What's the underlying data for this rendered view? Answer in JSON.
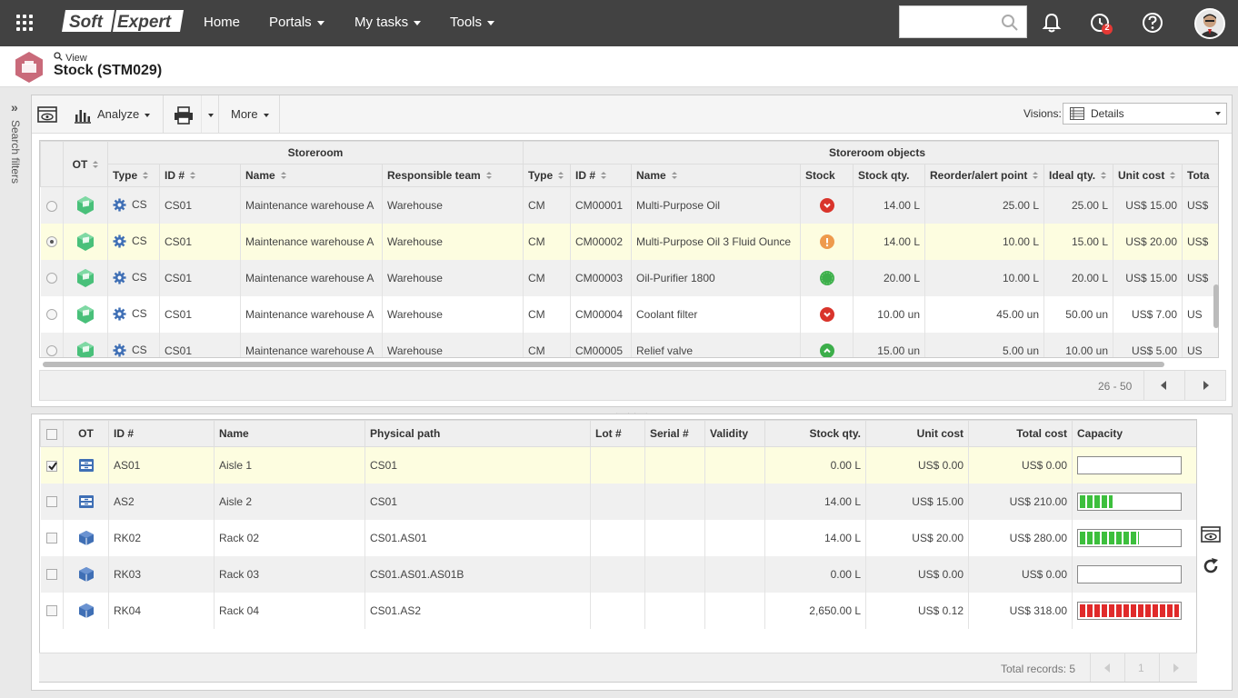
{
  "nav": {
    "logo_soft": "Soft",
    "logo_expert": "Expert",
    "items": [
      {
        "label": "Home",
        "dropdown": false
      },
      {
        "label": "Portals",
        "dropdown": true
      },
      {
        "label": "My tasks",
        "dropdown": true
      },
      {
        "label": "Tools",
        "dropdown": true
      }
    ],
    "search_placeholder": "",
    "task_badge": "2"
  },
  "header": {
    "view_link": "View",
    "title": "Stock (STM029)"
  },
  "left_rail": {
    "label": "Search filters"
  },
  "toolbar": {
    "analyze_label": "Analyze",
    "more_label": "More",
    "visions_label": "Visions:",
    "visions_value": "Details"
  },
  "grid1": {
    "group_headers": {
      "ot": "OT",
      "storeroom": "Storeroom",
      "objects": "Storeroom objects"
    },
    "columns": {
      "s_type": "Type",
      "s_id": "ID #",
      "s_name": "Name",
      "s_team": "Responsible team",
      "o_type": "Type",
      "o_id": "ID #",
      "o_name": "Name",
      "o_stock": "Stock",
      "o_qty": "Stock qty.",
      "o_reorder": "Reorder/alert point",
      "o_ideal": "Ideal qty.",
      "o_unit": "Unit cost",
      "o_total": "Tota"
    },
    "rows": [
      {
        "s_type": "CS",
        "s_id": "CS01",
        "s_name": "Maintenance warehouse A",
        "s_team": "Warehouse",
        "o_type": "CM",
        "o_id": "CM00001",
        "o_name": "Multi-Purpose Oil",
        "stock_status": "below",
        "qty": "14.00 L",
        "reorder": "25.00 L",
        "ideal": "25.00 L",
        "unit": "US$ 15.00",
        "total": "US$"
      },
      {
        "s_type": "CS",
        "s_id": "CS01",
        "s_name": "Maintenance warehouse A",
        "s_team": "Warehouse",
        "o_type": "CM",
        "o_id": "CM00002",
        "o_name": "Multi-Purpose Oil 3 Fluid Ounce",
        "stock_status": "alert",
        "qty": "14.00 L",
        "reorder": "10.00 L",
        "ideal": "15.00 L",
        "unit": "US$ 20.00",
        "total": "US$"
      },
      {
        "s_type": "CS",
        "s_id": "CS01",
        "s_name": "Maintenance warehouse A",
        "s_team": "Warehouse",
        "o_type": "CM",
        "o_id": "CM00003",
        "o_name": "Oil-Purifier 1800",
        "stock_status": "ok",
        "qty": "20.00 L",
        "reorder": "10.00 L",
        "ideal": "20.00 L",
        "unit": "US$ 15.00",
        "total": "US$"
      },
      {
        "s_type": "CS",
        "s_id": "CS01",
        "s_name": "Maintenance warehouse A",
        "s_team": "Warehouse",
        "o_type": "CM",
        "o_id": "CM00004",
        "o_name": "Coolant filter",
        "stock_status": "below",
        "qty": "10.00 un",
        "reorder": "45.00 un",
        "ideal": "50.00 un",
        "unit": "US$ 7.00",
        "total": "US"
      },
      {
        "s_type": "CS",
        "s_id": "CS01",
        "s_name": "Maintenance warehouse A",
        "s_team": "Warehouse",
        "o_type": "CM",
        "o_id": "CM00005",
        "o_name": "Relief valve",
        "stock_status": "above",
        "qty": "15.00 un",
        "reorder": "5.00 un",
        "ideal": "10.00 un",
        "unit": "US$ 5.00",
        "total": "US"
      }
    ],
    "range": "26 - 50"
  },
  "grid2": {
    "columns": {
      "ot": "OT",
      "id": "ID #",
      "name": "Name",
      "path": "Physical path",
      "lot": "Lot #",
      "serial": "Serial #",
      "validity": "Validity",
      "qty": "Stock qty.",
      "unit": "Unit cost",
      "total": "Total cost",
      "capacity": "Capacity"
    },
    "rows": [
      {
        "kind": "aisle",
        "id": "AS01",
        "name": "Aisle 1",
        "path": "CS01",
        "lot": "",
        "serial": "",
        "validity": "",
        "qty": "0.00 L",
        "unit": "US$ 0.00",
        "total": "US$ 0.00",
        "capacity": 0,
        "cap_color": "green",
        "checked": true
      },
      {
        "kind": "aisle",
        "id": "AS2",
        "name": "Aisle 2",
        "path": "CS01",
        "lot": "",
        "serial": "",
        "validity": "",
        "qty": "14.00 L",
        "unit": "US$ 15.00",
        "total": "US$ 210.00",
        "capacity": 0.33,
        "cap_color": "green",
        "checked": false
      },
      {
        "kind": "rack",
        "id": "RK02",
        "name": "Rack 02",
        "path": "CS01.AS01",
        "lot": "",
        "serial": "",
        "validity": "",
        "qty": "14.00 L",
        "unit": "US$ 20.00",
        "total": "US$ 280.00",
        "capacity": 0.6,
        "cap_color": "green",
        "checked": false
      },
      {
        "kind": "rack",
        "id": "RK03",
        "name": "Rack 03",
        "path": "CS01.AS01.AS01B",
        "lot": "",
        "serial": "",
        "validity": "",
        "qty": "0.00 L",
        "unit": "US$ 0.00",
        "total": "US$ 0.00",
        "capacity": 0,
        "cap_color": "green",
        "checked": false
      },
      {
        "kind": "rack",
        "id": "RK04",
        "name": "Rack 04",
        "path": "CS01.AS2",
        "lot": "",
        "serial": "",
        "validity": "",
        "qty": "2,650.00 L",
        "unit": "US$ 0.12",
        "total": "US$ 318.00",
        "capacity": 1.0,
        "cap_color": "red",
        "checked": false
      }
    ],
    "total_records": "Total records: 5",
    "page": "1"
  }
}
